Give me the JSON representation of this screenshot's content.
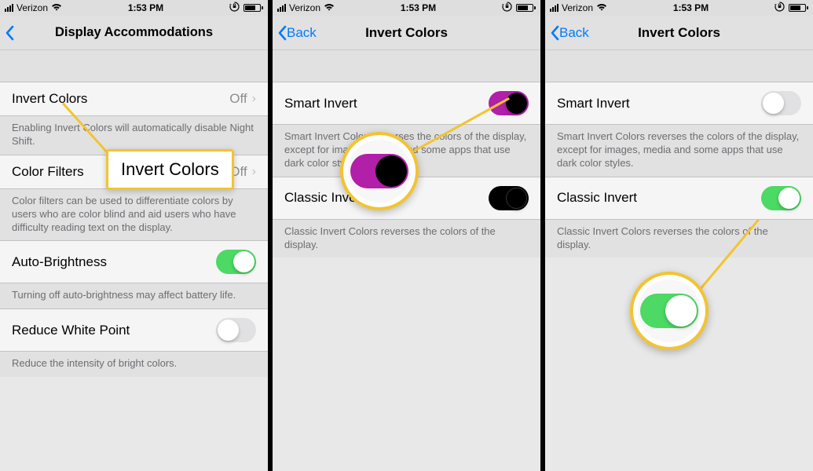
{
  "status": {
    "carrier": "Verizon",
    "time": "1:53 PM"
  },
  "p1": {
    "title": "Display Accommodations",
    "row1": {
      "label": "Invert Colors",
      "value": "Off"
    },
    "footer1": "Enabling Invert Colors will automatically disable Night Shift.",
    "row2": {
      "label": "Color Filters",
      "value": "Off"
    },
    "footer2": "Color filters can be used to differentiate colors by users who are color blind and aid users who have difficulty reading text on the display.",
    "row3": {
      "label": "Auto-Brightness"
    },
    "footer3": "Turning off auto-brightness may affect battery life.",
    "row4": {
      "label": "Reduce White Point"
    },
    "footer4": "Reduce the intensity of bright colors.",
    "callout": "Invert Colors"
  },
  "p2": {
    "back": "Back",
    "title": "Invert Colors",
    "row1": {
      "label": "Smart Invert"
    },
    "footer1": "Smart Invert Colors reverses the colors of the display, except for images, media and some apps that use dark color styles.",
    "row2": {
      "label": "Classic Invert"
    },
    "footer2": "Classic Invert Colors reverses the colors of the display."
  },
  "p3": {
    "back": "Back",
    "title": "Invert Colors",
    "row1": {
      "label": "Smart Invert"
    },
    "footer1": "Smart Invert Colors reverses the colors of the display, except for images, media and some apps that use dark color styles.",
    "row2": {
      "label": "Classic Invert"
    },
    "footer2": "Classic Invert Colors reverses the colors of the display."
  }
}
